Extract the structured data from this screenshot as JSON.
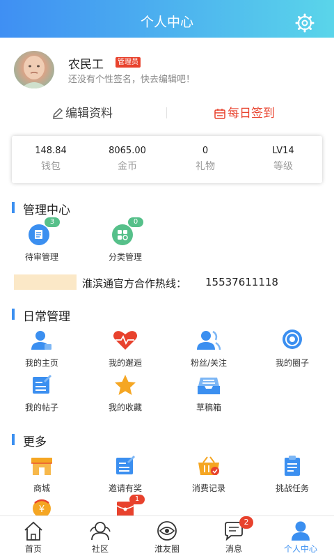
{
  "header": {
    "title": "个人中心",
    "settings_icon": "gear-icon"
  },
  "profile": {
    "name": "农民工",
    "role": "管理员",
    "signature": "还没有个性签名，快去编辑吧！"
  },
  "actions": {
    "edit_label": "编辑资料",
    "sign_label": "每日签到"
  },
  "stats": [
    {
      "value": "148.84",
      "label": "钱包"
    },
    {
      "value": "8065.00",
      "label": "金币"
    },
    {
      "value": "0",
      "label": "礼物"
    },
    {
      "value": "LV14",
      "label": "等级"
    }
  ],
  "admin": {
    "title": "管理中心",
    "items": [
      {
        "label": "待审管理",
        "badge": "3",
        "icon": "review-doc-icon"
      },
      {
        "label": "分类管理",
        "badge": "0",
        "icon": "category-grid-icon"
      }
    ]
  },
  "hotline": {
    "label": "淮滨通官方合作热线：",
    "number": "15537611118"
  },
  "daily": {
    "title": "日常管理",
    "items": [
      {
        "label": "我的主页",
        "icon": "user-home-icon"
      },
      {
        "label": "我的邂逅",
        "icon": "heart-pulse-icon"
      },
      {
        "label": "粉丝/关注",
        "icon": "fans-icon"
      },
      {
        "label": "我的圈子",
        "icon": "circle-target-icon"
      },
      {
        "label": "我的帖子",
        "icon": "post-edit-icon"
      },
      {
        "label": "我的收藏",
        "icon": "star-icon"
      },
      {
        "label": "草稿箱",
        "icon": "inbox-tray-icon"
      }
    ]
  },
  "more": {
    "title": "更多",
    "items": [
      {
        "label": "商城",
        "icon": "shop-icon"
      },
      {
        "label": "邀请有奖",
        "icon": "invite-edit-icon"
      },
      {
        "label": "消费记录",
        "icon": "basket-icon"
      },
      {
        "label": "挑战任务",
        "icon": "clipboard-task-icon"
      },
      {
        "icon": "coin-exchange-icon"
      },
      {
        "badge": "1",
        "icon": "red-envelope-icon"
      }
    ]
  },
  "tabbar": {
    "items": [
      {
        "label": "首页",
        "icon": "home-icon"
      },
      {
        "label": "社区",
        "icon": "community-icon"
      },
      {
        "label": "淮友圈",
        "icon": "eye-circle-icon"
      },
      {
        "label": "消息",
        "icon": "message-icon",
        "badge": "2"
      },
      {
        "label": "个人中心",
        "icon": "person-icon"
      }
    ],
    "active_color": "#3b8ff0"
  },
  "colors": {
    "accent": "#3b8ff0",
    "danger": "#e8422d",
    "badge_green": "#56c08a"
  }
}
